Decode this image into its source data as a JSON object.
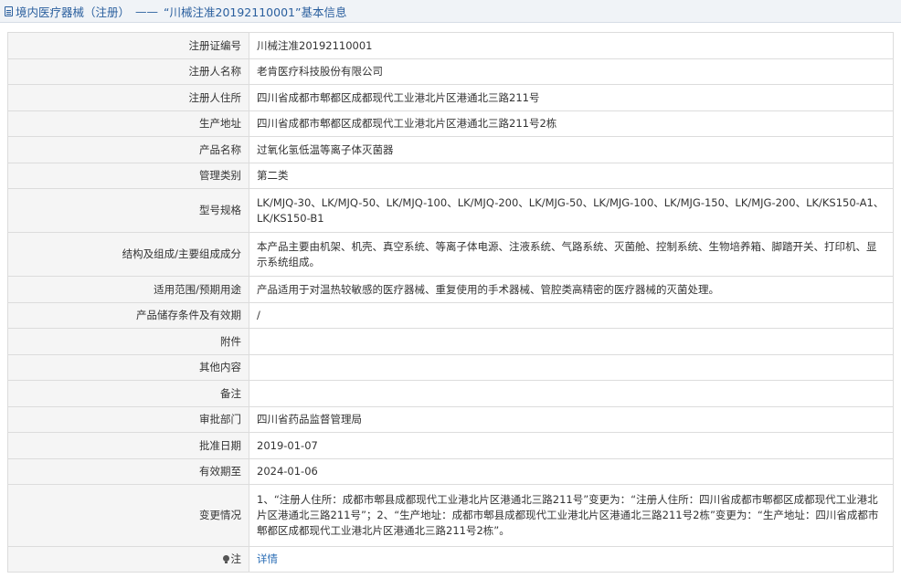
{
  "header": {
    "title_prefix": "境内医疗器械（注册）",
    "separator": "——",
    "title_suffix": "“川械注准20192110001”基本信息"
  },
  "rows": [
    {
      "label": "注册证编号",
      "value": "川械注准20192110001"
    },
    {
      "label": "注册人名称",
      "value": "老肯医疗科技股份有限公司"
    },
    {
      "label": "注册人住所",
      "value": "四川省成都市郫都区成都现代工业港北片区港通北三路211号"
    },
    {
      "label": "生产地址",
      "value": "四川省成都市郫都区成都现代工业港北片区港通北三路211号2栋"
    },
    {
      "label": "产品名称",
      "value": "过氧化氢低温等离子体灭菌器"
    },
    {
      "label": "管理类别",
      "value": "第二类"
    },
    {
      "label": "型号规格",
      "value": "LK/MJQ-30、LK/MJQ-50、LK/MJQ-100、LK/MJQ-200、LK/MJG-50、LK/MJG-100、LK/MJG-150、LK/MJG-200、LK/KS150-A1、LK/KS150-B1"
    },
    {
      "label": "结构及组成/主要组成成分",
      "value": "本产品主要由机架、机壳、真空系统、等离子体电源、注液系统、气路系统、灭菌舱、控制系统、生物培养箱、脚踏开关、打印机、显示系统组成。"
    },
    {
      "label": "适用范围/预期用途",
      "value": "产品适用于对温热较敏感的医疗器械、重复使用的手术器械、管腔类高精密的医疗器械的灭菌处理。"
    },
    {
      "label": "产品储存条件及有效期",
      "value": "/"
    },
    {
      "label": "附件",
      "value": ""
    },
    {
      "label": "其他内容",
      "value": ""
    },
    {
      "label": "备注",
      "value": ""
    },
    {
      "label": "审批部门",
      "value": "四川省药品监督管理局"
    },
    {
      "label": "批准日期",
      "value": "2019-01-07"
    },
    {
      "label": "有效期至",
      "value": "2024-01-06"
    },
    {
      "label": "变更情况",
      "value": "1、“注册人住所：成都市郫县成都现代工业港北片区港通北三路211号”变更为：“注册人住所：四川省成都市郫都区成都现代工业港北片区港通北三路211号”；2、“生产地址：成都市郫县成都现代工业港北片区港通北三路211号2栋”变更为：“生产地址：四川省成都市郫都区成都现代工业港北片区港通北三路211号2栋”。"
    }
  ],
  "note": {
    "label": "注",
    "icon": "lightbulb-icon",
    "link_text": "详情"
  }
}
